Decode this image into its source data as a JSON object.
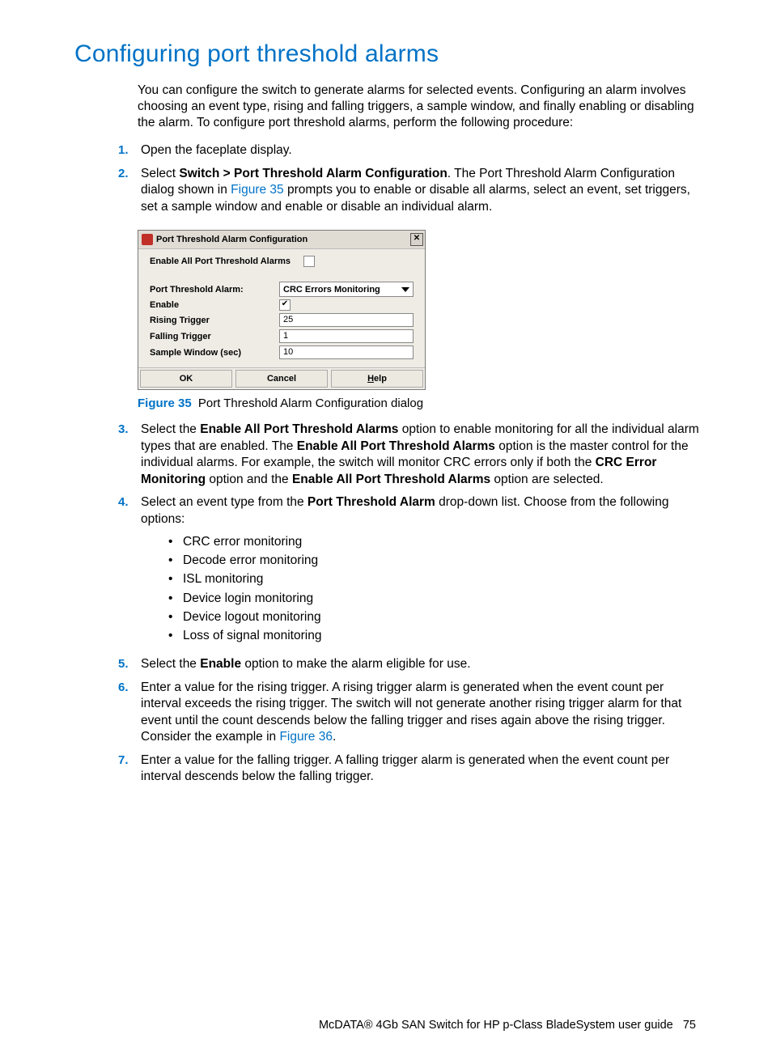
{
  "heading": "Configuring port threshold alarms",
  "intro": "You can configure the switch to generate alarms for selected events. Configuring an alarm involves choosing an event type, rising and falling triggers, a sample window, and finally enabling or disabling the alarm. To configure port threshold alarms, perform the following procedure:",
  "step1": "Open the faceplate display.",
  "step2_pre": "Select ",
  "step2_bold": "Switch > Port Threshold Alarm Configuration",
  "step2_mid": ". The Port Threshold Alarm Configuration dialog shown in ",
  "step2_link": "Figure 35",
  "step2_post": " prompts you to enable or disable all alarms, select an event, set triggers, set a sample window and enable or disable an individual alarm.",
  "dialog": {
    "title": "Port Threshold Alarm Configuration",
    "enable_all_label": "Enable All Port Threshold Alarms",
    "alarm_label": "Port Threshold Alarm:",
    "alarm_value": "CRC Errors Monitoring",
    "enable_label": "Enable",
    "enable_checked": "✔",
    "rising_label": "Rising Trigger",
    "rising_value": "25",
    "falling_label": "Falling Trigger",
    "falling_value": "1",
    "sample_label": "Sample Window (sec)",
    "sample_value": "10",
    "ok": "OK",
    "cancel": "Cancel",
    "help_h": "H",
    "help_rest": "elp"
  },
  "fig_label": "Figure 35",
  "fig_caption": " Port Threshold Alarm Configuration dialog",
  "step3_a": "Select the ",
  "step3_b1": "Enable All Port Threshold Alarms",
  "step3_c": " option to enable monitoring for all the individual alarm types that are enabled. The ",
  "step3_b2": "Enable All Port Threshold Alarms",
  "step3_d": " option is the master control for the individual alarms. For example, the switch will monitor CRC errors only if both the ",
  "step3_b3": "CRC Error Monitoring",
  "step3_e": " option and the ",
  "step3_b4": "Enable All Port Threshold Alarms",
  "step3_f": " option are selected.",
  "step4_a": "Select an event type from the ",
  "step4_b": "Port Threshold Alarm",
  "step4_c": " drop-down list. Choose from the following options:",
  "opts": {
    "o1": "CRC error monitoring",
    "o2": "Decode error monitoring",
    "o3": "ISL monitoring",
    "o4": "Device login monitoring",
    "o5": "Device logout monitoring",
    "o6": "Loss of signal monitoring"
  },
  "step5_a": "Select the ",
  "step5_b": "Enable",
  "step5_c": " option to make the alarm eligible for use.",
  "step6_a": "Enter a value for the rising trigger. A rising trigger alarm is generated when the event count per interval exceeds the rising trigger. The switch will not generate another rising trigger alarm for that event until the count descends below the falling trigger and rises again above the rising trigger. Consider the example in ",
  "step6_link": "Figure 36",
  "step6_b": ".",
  "step7": "Enter a value for the falling trigger. A falling trigger alarm is generated when the event count per interval descends below the falling trigger.",
  "footer_text": "McDATA® 4Gb SAN Switch for HP p-Class BladeSystem user guide",
  "footer_page": "75"
}
